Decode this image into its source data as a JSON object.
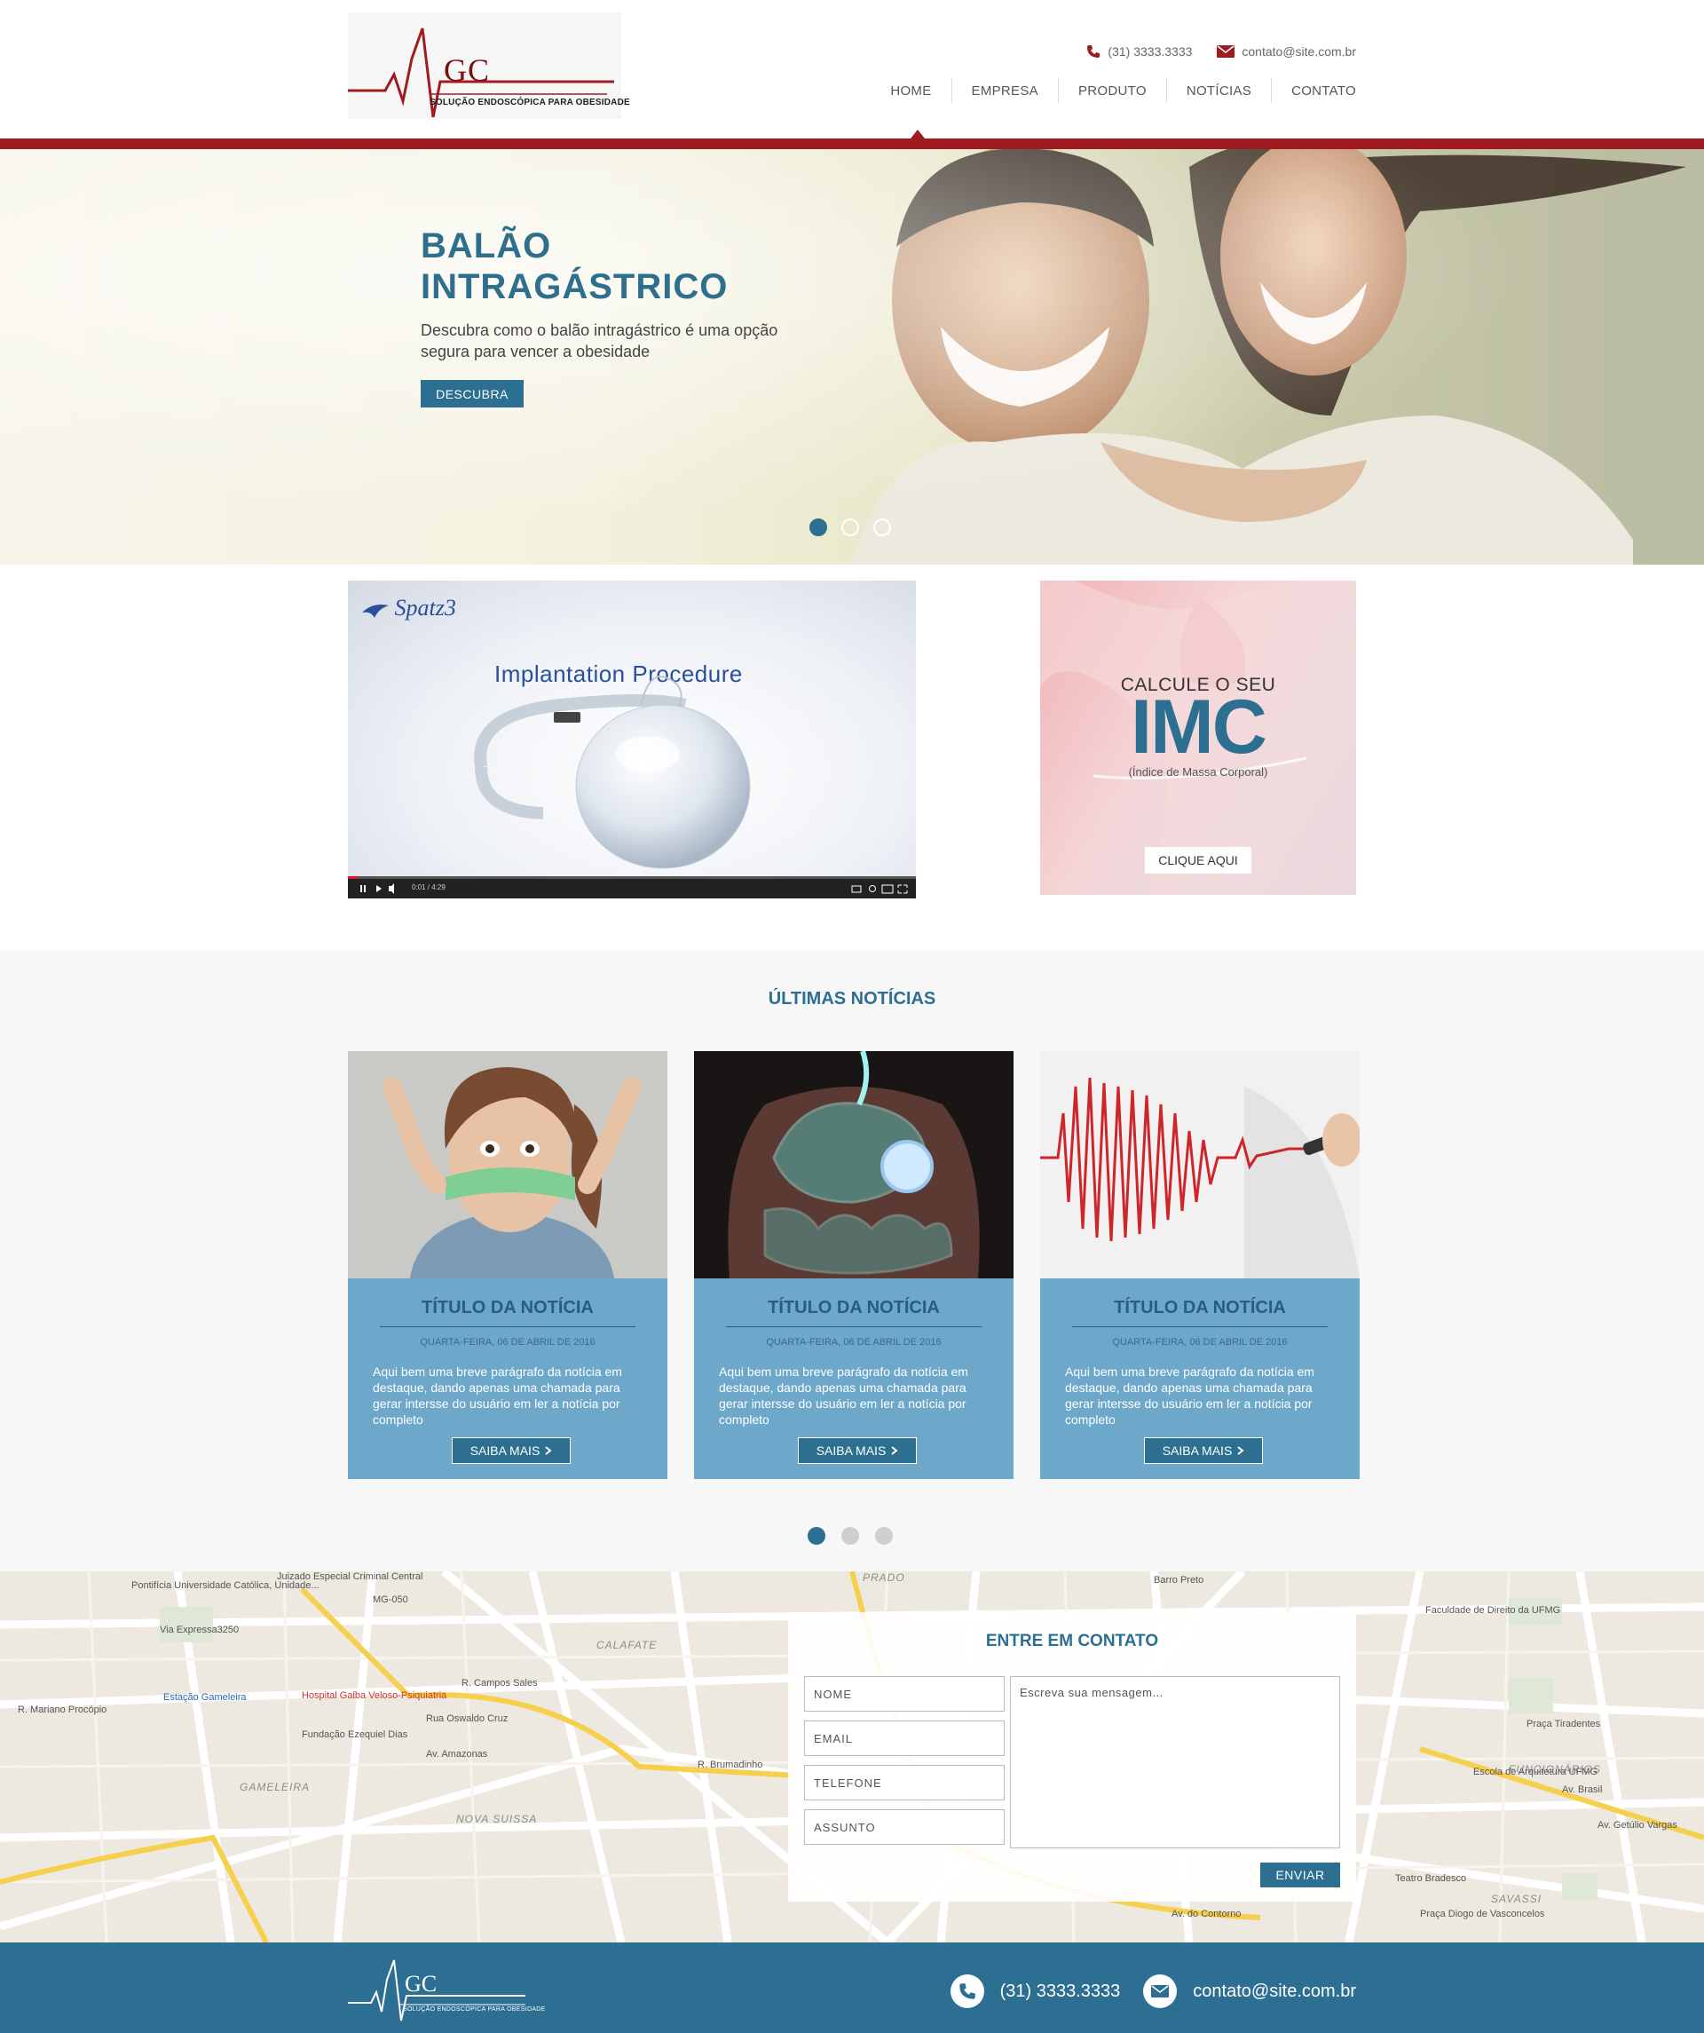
{
  "header": {
    "logo_text": "GC",
    "logo_tagline": "SOLUÇÃO ENDOSCÓPICA PARA OBESIDADE",
    "phone": "(31) 3333.3333",
    "email": "contato@site.com.br",
    "nav": [
      "HOME",
      "EMPRESA",
      "PRODUTO",
      "NOTÍCIAS",
      "CONTATO"
    ],
    "active_nav": "HOME"
  },
  "hero": {
    "title_line1": "BALÃO",
    "title_line2": "INTRAGÁSTRICO",
    "text": "Descubra como o balão intragástrico é uma opção segura para vencer a obesidade",
    "button": "DESCUBRA",
    "slides": 3,
    "active_slide": 1
  },
  "video": {
    "brand": "Spatz3",
    "caption": "Implantation  Procedure",
    "time": "0:01 / 4:29"
  },
  "imc": {
    "calc": "CALCULE O SEU",
    "big": "IMC",
    "sub": "(Índice de Massa Corporal)",
    "button": "CLIQUE AQUI"
  },
  "news": {
    "title": "ÚLTIMAS NOTÍCIAS",
    "cards": [
      {
        "title": "TÍTULO DA NOTÍCIA",
        "date": "QUARTA-FEIRA, 06 DE ABRIL DE 2016",
        "body": "Aqui bem uma breve parágrafo da notícia em destaque, dando apenas uma chamada para gerar intersse do usuário em ler a notícia por completo",
        "button": "SAIBA MAIS"
      },
      {
        "title": "TÍTULO DA NOTÍCIA",
        "date": "QUARTA-FEIRA, 06 DE ABRIL DE 2016",
        "body": "Aqui bem uma breve parágrafo da notícia em destaque, dando apenas uma chamada para gerar intersse do usuário em ler a notícia por completo",
        "button": "SAIBA MAIS"
      },
      {
        "title": "TÍTULO DA NOTÍCIA",
        "date": "QUARTA-FEIRA, 06 DE ABRIL DE 2016",
        "body": "Aqui bem uma breve parágrafo da notícia em destaque, dando apenas uma chamada para gerar intersse do usuário em ler a notícia por completo",
        "button": "SAIBA MAIS"
      }
    ],
    "pages": 3,
    "active_page": 1
  },
  "map": {
    "labels": [
      "Pontifícia Universidade Católica, Unidade...",
      "Via Expressa3250",
      "Estação Gameleira",
      "Hospital Galba Veloso-Psiquiatria",
      "Fundação Ezequiel Dias",
      "R. Mariano Procópio",
      "R. Campos Sales",
      "Rua Oswaldo Cruz",
      "Av. Amazonas",
      "GAMELEIRA",
      "NOVA SUISSA",
      "CALAFATE",
      "PRADO",
      "Barro Preto",
      "Faculdade de Direito da UFMG",
      "FUNCIONÁRIOS",
      "SAVASSI",
      "Praça Tiradentes",
      "Escola de Arquitetura UFMG",
      "Av. Brasil",
      "Av. Getúlio Vargas",
      "R. Brumadinho",
      "Av. do Contorno",
      "Teatro Bradesco",
      "Praça Diogo de Vasconcelos",
      "MG-050",
      "Juizado Especial Criminal Central"
    ]
  },
  "contact": {
    "title": "ENTRE EM CONTATO",
    "fields": [
      "NOME",
      "EMAIL",
      "TELEFONE",
      "ASSUNTO"
    ],
    "message_placeholder": "Escreva sua mensagem...",
    "button": "ENVIAR"
  },
  "footer": {
    "logo_text": "GC",
    "logo_tagline": "SOLUÇÃO ENDOSCÓPICA PARA OBESIDADE",
    "phone": "(31) 3333.3333",
    "email": "contato@site.com.br"
  },
  "colors": {
    "brand_blue": "#2c6f90",
    "brand_red": "#9e1c20",
    "card_blue": "#6da8cb",
    "footer_blue": "#2d6e93"
  }
}
